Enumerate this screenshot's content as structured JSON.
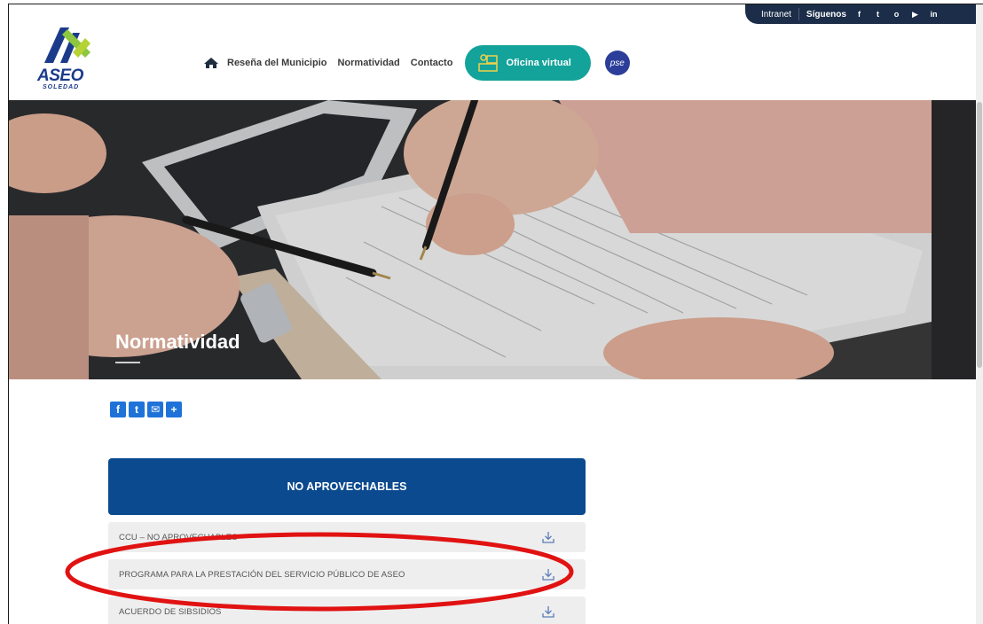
{
  "topbar": {
    "intranet": "Intranet",
    "siguenos": "Síguenos",
    "social": [
      "f",
      "t",
      "o",
      "▶",
      "in"
    ]
  },
  "logo": {
    "word": "ASEO",
    "sub": "SOLEDAD"
  },
  "nav": {
    "items": [
      "Reseña del Municipio",
      "Normatividad",
      "Contacto"
    ],
    "virtual_office": "Oficina virtual",
    "pse": "pse"
  },
  "hero": {
    "title": "Normatividad"
  },
  "share": [
    "f",
    "t",
    "✉",
    "+"
  ],
  "section": {
    "header": "NO APROVECHABLES",
    "rows": [
      "CCU – NO APROVECHABLES",
      "PROGRAMA PARA LA PRESTACIÓN DEL SERVICIO PÚBLICO DE ASEO",
      "ACUERDO DE SIBSIDIOS"
    ]
  },
  "colors": {
    "accent_blue": "#0b4a8f",
    "teal": "#13a39a",
    "annotation_red": "#e11212"
  }
}
